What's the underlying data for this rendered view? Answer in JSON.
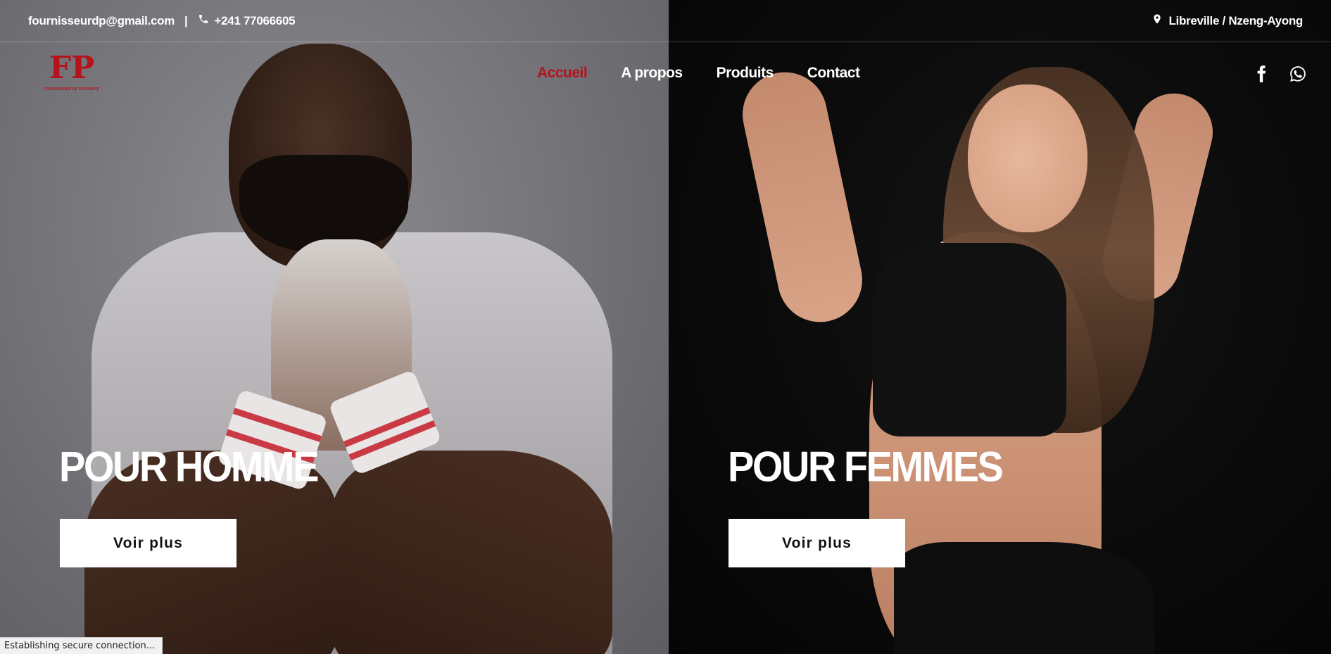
{
  "topbar": {
    "email": "fournisseurdp@gmail.com",
    "separator": "|",
    "phone": "+241 77066605",
    "location": "Libreville / Nzeng-Ayong",
    "phone_icon": "phone-icon",
    "location_icon": "map-marker-icon"
  },
  "logo": {
    "mark": "FP",
    "subtitle": "FOURNISSEUR DE PROXIMITÉ"
  },
  "nav": {
    "items": [
      {
        "label": "Accueil",
        "active": true
      },
      {
        "label": "A propos",
        "active": false
      },
      {
        "label": "Produits",
        "active": false
      },
      {
        "label": "Contact",
        "active": false
      }
    ]
  },
  "social": {
    "icons": [
      "facebook-icon",
      "whatsapp-icon"
    ]
  },
  "hero": {
    "left": {
      "title": "POUR HOMME",
      "button": "Voir plus"
    },
    "right": {
      "title": "POUR FEMMES",
      "button": "Voir plus"
    }
  },
  "status": {
    "text": "Establishing secure connection..."
  },
  "colors": {
    "accent": "#b5121b",
    "left_background": "#77767b",
    "right_background": "#0b0b0b",
    "button_background": "#ffffff"
  }
}
